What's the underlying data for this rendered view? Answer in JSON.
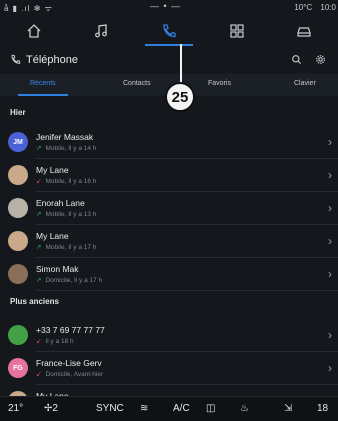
{
  "status": {
    "left_icons": "å ▮ .ıl ✻ ᯤ",
    "center": "— • —",
    "temperature": "10°C",
    "time": "10:0"
  },
  "nav": {
    "tabs": [
      {
        "name": "home-icon",
        "active": false
      },
      {
        "name": "music-icon",
        "active": false
      },
      {
        "name": "phone-icon",
        "active": true
      },
      {
        "name": "apps-icon",
        "active": false
      },
      {
        "name": "car-icon",
        "active": false
      }
    ]
  },
  "header": {
    "title": "Téléphone"
  },
  "subtabs": {
    "recents": "Récents",
    "contacts": "Contacts",
    "favoris": "Favoris",
    "clavier": "Clavier"
  },
  "callout": "25",
  "sections": {
    "hier": "Hier",
    "plus_anciens": "Plus anciens"
  },
  "calls": [
    {
      "name": "Jenifer Massak",
      "sub": "Mobile, Il y a 14 h",
      "initials": "JM",
      "avatar_color": "#4b62d6",
      "type": "out"
    },
    {
      "name": "My Lane",
      "sub": "Mobile, Il y a 16 h",
      "initials": "",
      "avatar_color": "#c9a98a",
      "type": "missed"
    },
    {
      "name": "Enorah Lane",
      "sub": "Mobile, Il y a 13 h",
      "initials": "",
      "avatar_color": "#b8b1a8",
      "type": "out"
    },
    {
      "name": "My Lane",
      "sub": "Mobile, Il y a 17 h",
      "initials": "",
      "avatar_color": "#c9a98a",
      "type": "out"
    },
    {
      "name": "Simon Mak",
      "sub": "Domicile, Il y a 17 h",
      "initials": "",
      "avatar_color": "#8a6f58",
      "type": "out"
    },
    {
      "name": "+33 7 69 77 77 77",
      "sub": "Il y a 18 h",
      "initials": "",
      "avatar_color": "#43a047",
      "type": "missed"
    },
    {
      "name": "France-Lise Gerv",
      "sub": "Domicile, Avant-hier",
      "initials": "FG",
      "avatar_color": "#e5739c",
      "type": "missed"
    },
    {
      "name": "My Lane",
      "sub": "",
      "initials": "",
      "avatar_color": "#c9a98a",
      "type": "out"
    }
  ],
  "bottom": {
    "temp_left": "21°",
    "fan": "2",
    "sync": "SYNC",
    "ac": "A/C",
    "temp_right": "18"
  }
}
